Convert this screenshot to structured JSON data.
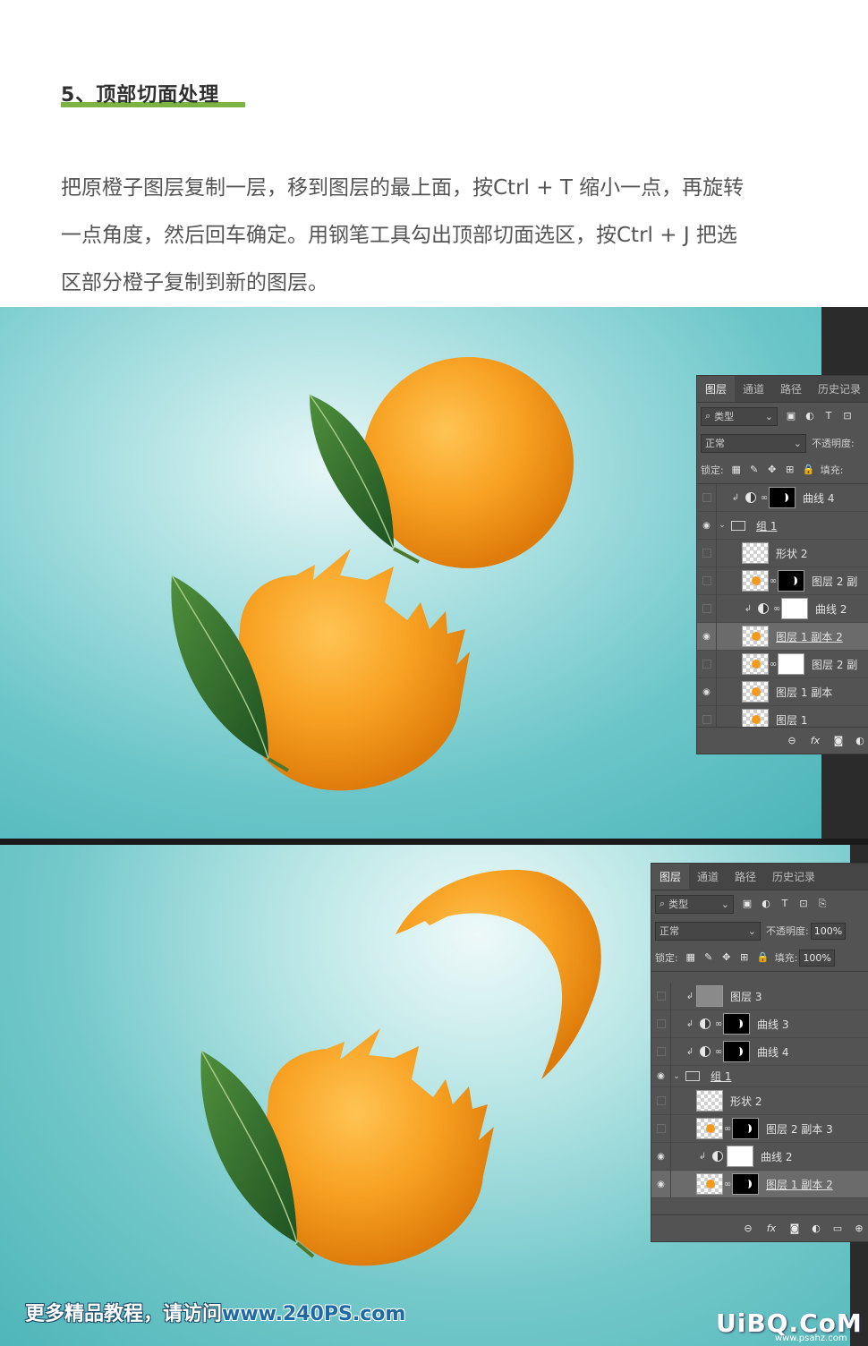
{
  "heading": "5、顶部切面处理",
  "colors": {
    "accent": "#7cb342",
    "orange": "#f39a1c",
    "leaf": "#2f6b2a",
    "teal": "#5fbfc2"
  },
  "paragraph": [
    "把原橙子图层复制一层，移到图层的最上面，按Ctrl + T 缩小一点，再旋转",
    "一点角度，然后回车确定。用钢笔工具勾出顶部切面选区，按Ctrl + J 把选",
    "区部分橙子复制到新的图层。"
  ],
  "panel1": {
    "tabs": [
      "图层",
      "通道",
      "路径",
      "历史记录"
    ],
    "filter": "类型",
    "blend_mode": "正常",
    "opacity_label": "不透明度:",
    "lock_label": "锁定:",
    "fill_label": "填充:",
    "layers": [
      {
        "name": "曲线 4",
        "visible": false
      },
      {
        "name": "组 1",
        "visible": true
      },
      {
        "name": "形状 2",
        "visible": false
      },
      {
        "name": "图层 2 副",
        "visible": false
      },
      {
        "name": "曲线 2",
        "visible": false
      },
      {
        "name": "图层 1 副本 2",
        "visible": true,
        "selected": true
      },
      {
        "name": "图层 2 副",
        "visible": false
      },
      {
        "name": "图层 1 副本",
        "visible": true
      },
      {
        "name": "图层 1",
        "visible": false
      }
    ],
    "footer_fx": "fx"
  },
  "panel2": {
    "tabs": [
      "图层",
      "通道",
      "路径",
      "历史记录"
    ],
    "filter": "类型",
    "blend_mode": "正常",
    "opacity_label": "不透明度:",
    "opacity_value": "100%",
    "lock_label": "锁定:",
    "fill_label": "填充:",
    "fill_value": "100%",
    "layers": [
      {
        "name": "图层 3",
        "visible": false
      },
      {
        "name": "曲线 3",
        "visible": false
      },
      {
        "name": "曲线 4",
        "visible": false
      },
      {
        "name": "组 1",
        "visible": true
      },
      {
        "name": "形状 2",
        "visible": false
      },
      {
        "name": "图层 2 副本 3",
        "visible": false
      },
      {
        "name": "曲线 2",
        "visible": true
      },
      {
        "name": "图层 1 副本 2",
        "visible": true,
        "selected": true
      }
    ],
    "footer_fx": "fx"
  },
  "watermark": {
    "left_text": "更多精品教程，请访问",
    "left_site": "www.240PS.com",
    "right_logo": "UiBQ.CoM",
    "right_sub": "www.psahz.com"
  }
}
